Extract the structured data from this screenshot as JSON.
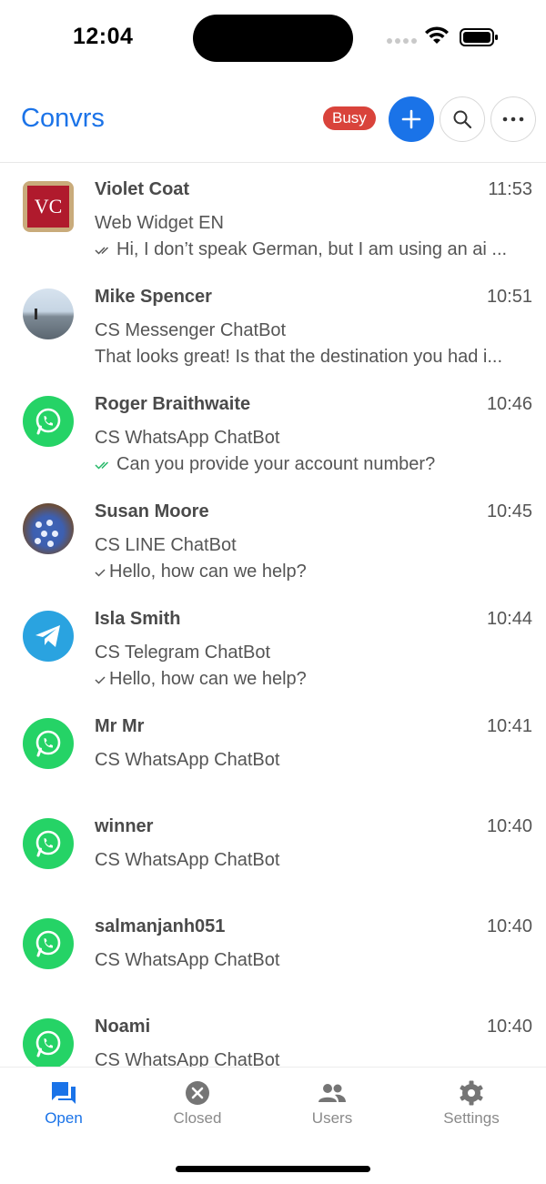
{
  "status_bar": {
    "time": "12:04"
  },
  "header": {
    "title": "Convrs",
    "status_badge": "Busy",
    "accent_color": "#1a73e8",
    "badge_color": "#d9433b"
  },
  "conversations": [
    {
      "name": "Violet Coat",
      "time": "11:53",
      "channel": "Web Widget EN",
      "preview": "Hi, I don’t speak German, but I am using an ai ...",
      "tick": "double-gray",
      "avatar": "VC"
    },
    {
      "name": "Mike Spencer",
      "time": "10:51",
      "channel": "CS Messenger ChatBot",
      "preview": "That looks great! Is that the destination you had i...",
      "tick": "none",
      "avatar": "photo"
    },
    {
      "name": "Roger Braithwaite",
      "time": "10:46",
      "channel": "CS WhatsApp ChatBot",
      "preview": "Can you provide your account number?",
      "tick": "double-green",
      "avatar": "whatsapp-icon"
    },
    {
      "name": "Susan Moore",
      "time": "10:45",
      "channel": "CS LINE ChatBot",
      "preview": "Hello, how can we help?",
      "tick": "single",
      "avatar": "photo"
    },
    {
      "name": "Isla Smith",
      "time": "10:44",
      "channel": "CS Telegram ChatBot",
      "preview": "Hello, how can we help?",
      "tick": "single",
      "avatar": "telegram-icon"
    },
    {
      "name": "Mr Mr",
      "time": "10:41",
      "channel": "CS WhatsApp ChatBot",
      "preview": "",
      "avatar": "whatsapp-icon"
    },
    {
      "name": "winner",
      "time": "10:40",
      "channel": "CS WhatsApp ChatBot",
      "preview": "",
      "avatar": "whatsapp-icon"
    },
    {
      "name": "salmanjanh051",
      "time": "10:40",
      "channel": "CS WhatsApp ChatBot",
      "preview": "",
      "avatar": "whatsapp-icon"
    },
    {
      "name": "Noami",
      "time": "10:40",
      "channel": "CS WhatsApp ChatBot",
      "preview": "",
      "avatar": "whatsapp-icon"
    }
  ],
  "tabs": [
    {
      "label": "Open",
      "icon": "chat-bubbles-icon",
      "active": true
    },
    {
      "label": "Closed",
      "icon": "close-circle-icon",
      "active": false
    },
    {
      "label": "Users",
      "icon": "users-icon",
      "active": false
    },
    {
      "label": "Settings",
      "icon": "gear-icon",
      "active": false
    }
  ]
}
